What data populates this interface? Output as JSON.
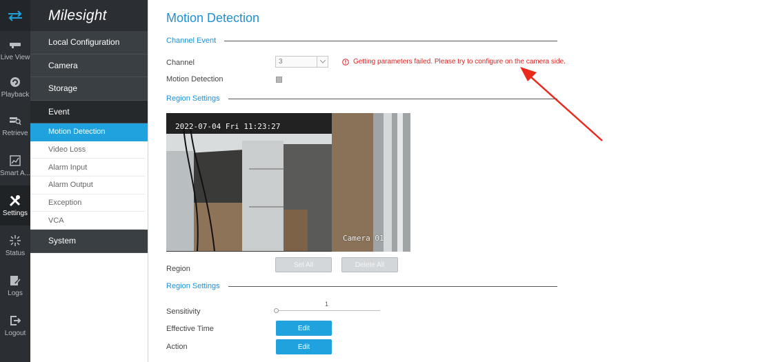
{
  "rail": {
    "items": [
      {
        "label": "Live View",
        "icon": "live-view-icon"
      },
      {
        "label": "Playback",
        "icon": "playback-icon"
      },
      {
        "label": "Retrieve",
        "icon": "retrieve-icon"
      },
      {
        "label": "Smart A...",
        "icon": "smart-analytics-icon"
      },
      {
        "label": "Settings",
        "icon": "settings-icon"
      },
      {
        "label": "Status",
        "icon": "status-icon"
      },
      {
        "label": "Logs",
        "icon": "logs-icon"
      },
      {
        "label": "Logout",
        "icon": "logout-icon"
      }
    ],
    "active": "Settings"
  },
  "brand": {
    "name": "Milesight"
  },
  "menu": {
    "local_configuration": "Local Configuration",
    "camera": "Camera",
    "storage": "Storage",
    "event": "Event",
    "event_items": [
      "Motion Detection",
      "Video Loss",
      "Alarm Input",
      "Alarm Output",
      "Exception",
      "VCA"
    ],
    "system": "System"
  },
  "page": {
    "title": "Motion Detection",
    "channel_event_title": "Channel Event",
    "channel_label": "Channel",
    "channel_value": "3",
    "motion_detection_label": "Motion Detection",
    "error_message": "Getting parameters failed. Please try to configure on the camera side.",
    "region_settings_title": "Region Settings",
    "preview": {
      "timestamp": "2022-07-04 Fri 11:23:27",
      "camera_name": "Camera 01"
    },
    "region_label": "Region",
    "set_all": "Set All",
    "delete_all": "Delete All",
    "region_settings_title_2": "Region Settings",
    "sensitivity_label": "Sensitivity",
    "sensitivity_value": "1",
    "effective_time_label": "Effective Time",
    "action_label": "Action",
    "edit_label": "Edit"
  },
  "colors": {
    "accent": "#1fa2de",
    "title": "#1e90d6",
    "error": "#e02020",
    "rail": "#2b2f33"
  }
}
